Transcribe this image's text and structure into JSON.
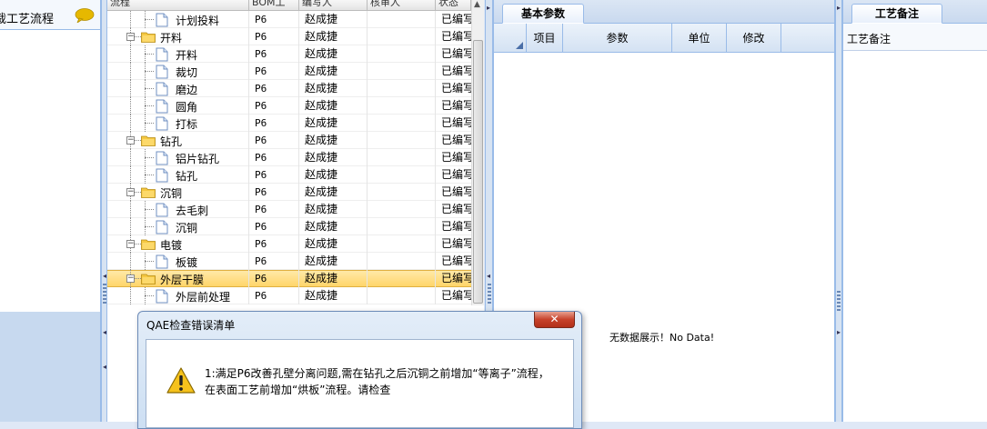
{
  "left": {
    "title": "裁工艺流程",
    "chat_icon": "speech-bubble-icon"
  },
  "tree": {
    "columns": [
      "流程",
      "BOM工",
      "编写人",
      "核审人",
      "状态"
    ],
    "rows": [
      {
        "type": "child",
        "name": "计划投料",
        "bom": "P6",
        "author": "赵成捷",
        "checker": "",
        "status": "已编写"
      },
      {
        "type": "parent",
        "name": "开料",
        "bom": "P6",
        "author": "赵成捷",
        "checker": "",
        "status": "已编写"
      },
      {
        "type": "child",
        "name": "开料",
        "bom": "P6",
        "author": "赵成捷",
        "checker": "",
        "status": "已编写"
      },
      {
        "type": "child",
        "name": "裁切",
        "bom": "P6",
        "author": "赵成捷",
        "checker": "",
        "status": "已编写"
      },
      {
        "type": "child",
        "name": "磨边",
        "bom": "P6",
        "author": "赵成捷",
        "checker": "",
        "status": "已编写"
      },
      {
        "type": "child",
        "name": "圆角",
        "bom": "P6",
        "author": "赵成捷",
        "checker": "",
        "status": "已编写"
      },
      {
        "type": "child",
        "name": "打标",
        "bom": "P6",
        "author": "赵成捷",
        "checker": "",
        "status": "已编写"
      },
      {
        "type": "parent",
        "name": "钻孔",
        "bom": "P6",
        "author": "赵成捷",
        "checker": "",
        "status": "已编写"
      },
      {
        "type": "child",
        "name": "铝片钻孔",
        "bom": "P6",
        "author": "赵成捷",
        "checker": "",
        "status": "已编写"
      },
      {
        "type": "child",
        "name": "钻孔",
        "bom": "P6",
        "author": "赵成捷",
        "checker": "",
        "status": "已编写"
      },
      {
        "type": "parent",
        "name": "沉铜",
        "bom": "P6",
        "author": "赵成捷",
        "checker": "",
        "status": "已编写"
      },
      {
        "type": "child",
        "name": "去毛刺",
        "bom": "P6",
        "author": "赵成捷",
        "checker": "",
        "status": "已编写"
      },
      {
        "type": "child",
        "name": "沉铜",
        "bom": "P6",
        "author": "赵成捷",
        "checker": "",
        "status": "已编写"
      },
      {
        "type": "parent",
        "name": "电镀",
        "bom": "P6",
        "author": "赵成捷",
        "checker": "",
        "status": "已编写"
      },
      {
        "type": "child",
        "name": "板镀",
        "bom": "P6",
        "author": "赵成捷",
        "checker": "",
        "status": "已编写"
      },
      {
        "type": "parent",
        "name": "外层干膜",
        "bom": "P6",
        "author": "赵成捷",
        "checker": "",
        "status": "已编写",
        "selected": true
      },
      {
        "type": "child",
        "name": "外层前处理",
        "bom": "P6",
        "author": "赵成捷",
        "checker": "",
        "status": "已编写"
      }
    ]
  },
  "params": {
    "tab": "基本参数",
    "columns": [
      "项目",
      "参数",
      "单位",
      "修改"
    ],
    "empty_text": "无数据展示！No Data!"
  },
  "remarks": {
    "tab": "工艺备注",
    "header": "工艺备注"
  },
  "dialog": {
    "title": "QAE检查错误清单",
    "close": "✕",
    "message": "1:满足P6改善孔壁分离问题,需在钻孔之后沉铜之前增加“等离子”流程，在表面工艺前增加“烘板”流程。请检查",
    "icon": "warning-icon"
  },
  "colors": {
    "accent": "#99bbe8",
    "selected": "#ffd56a",
    "close": "#c7422b"
  }
}
